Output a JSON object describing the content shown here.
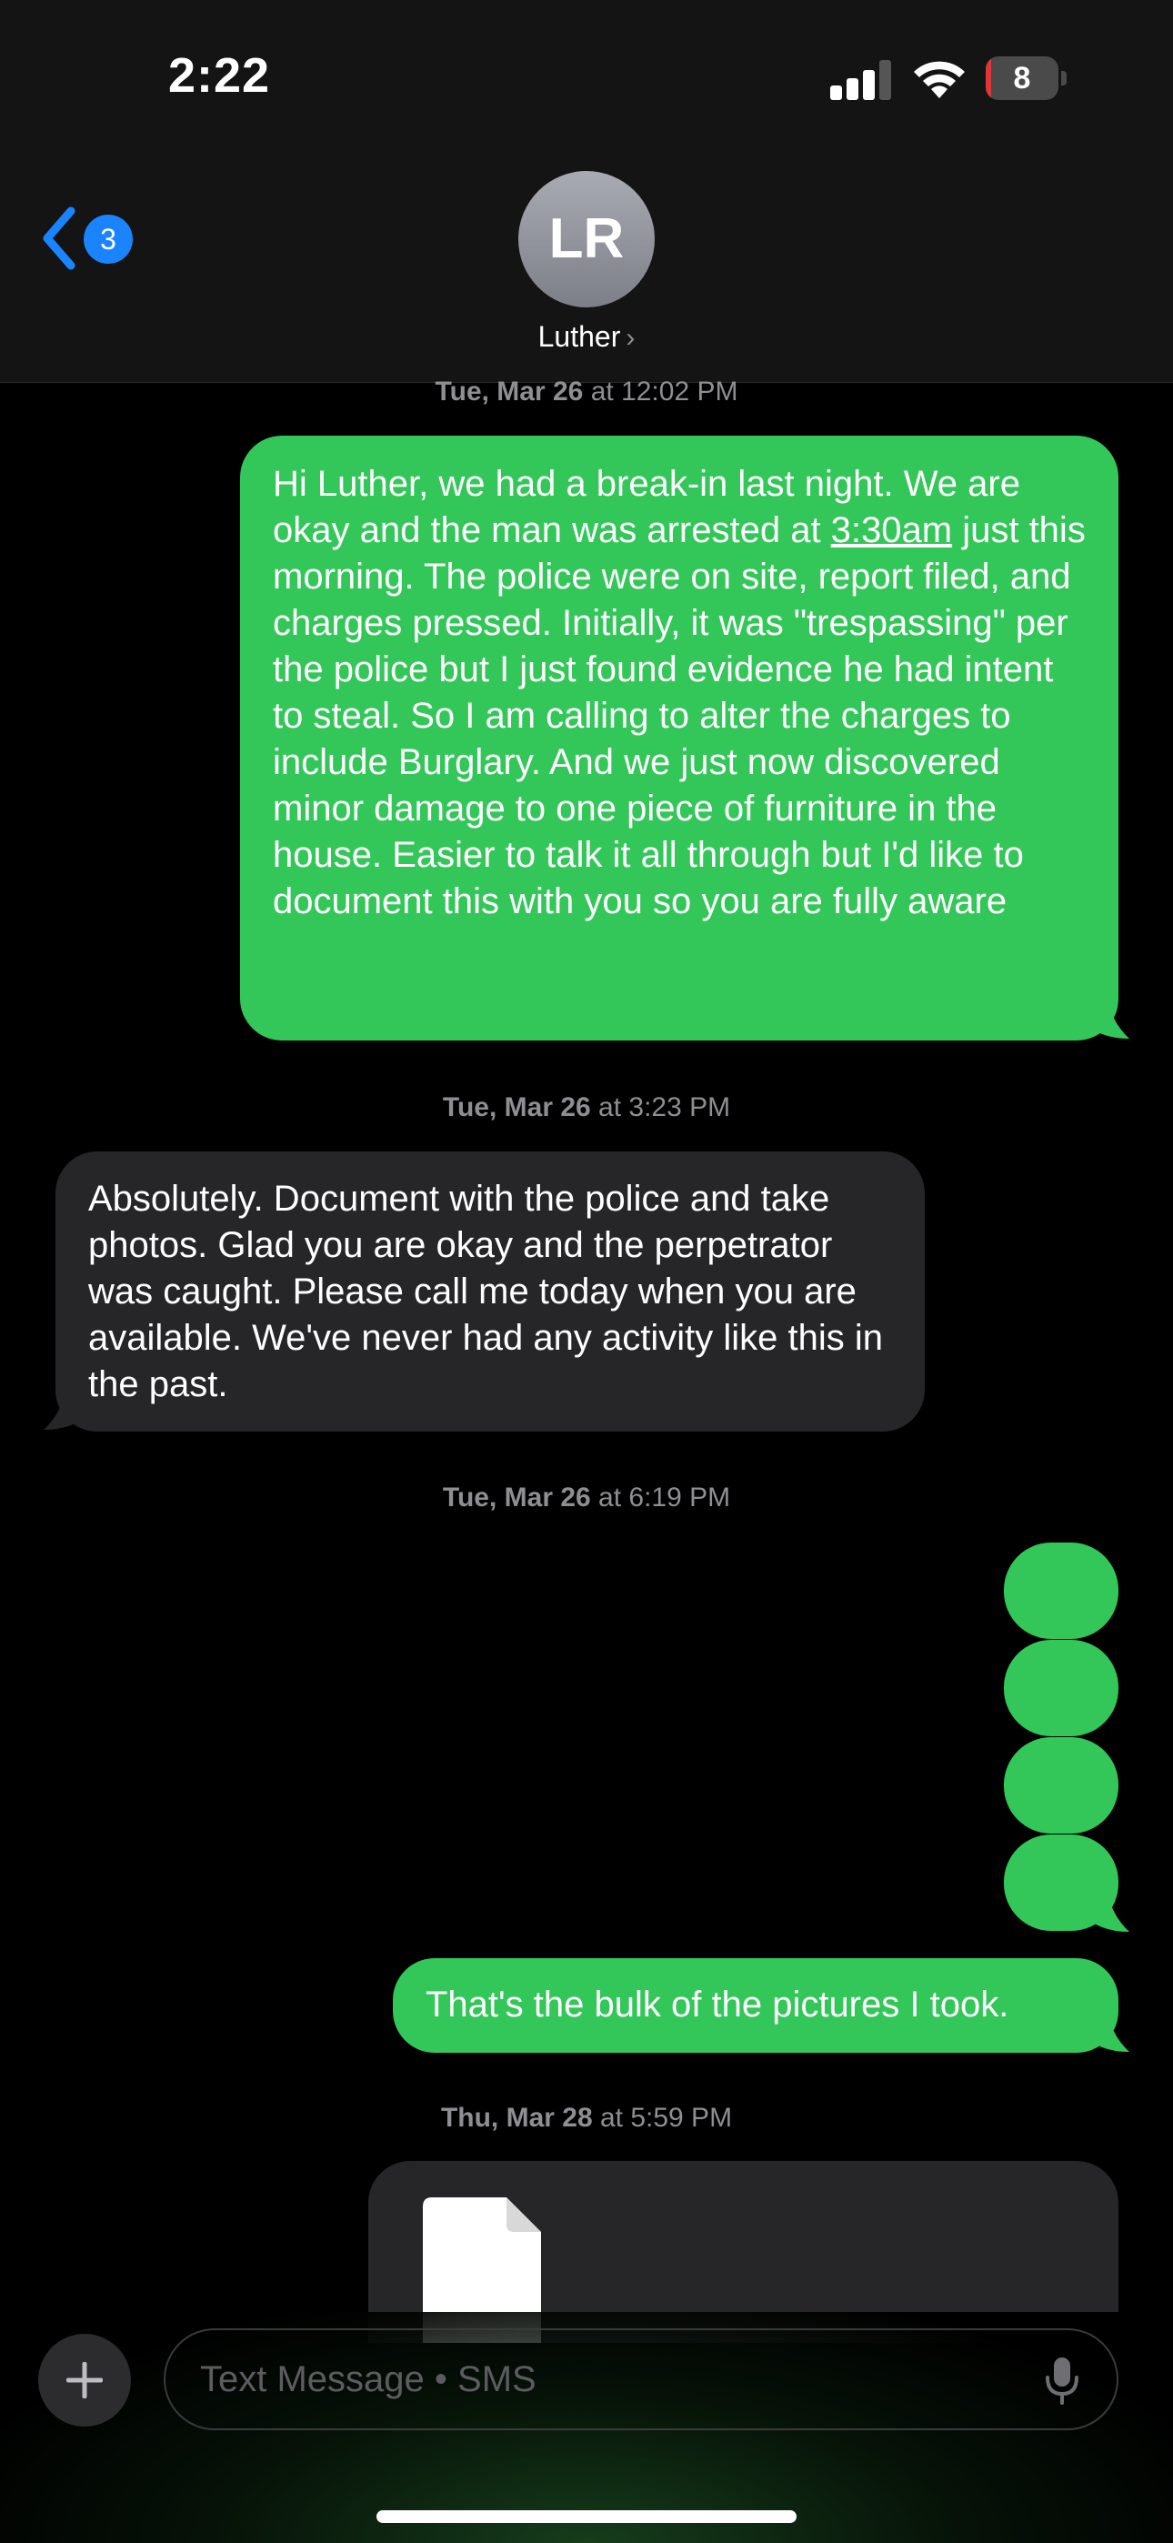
{
  "status_bar": {
    "time": "2:22",
    "battery_level": "8",
    "battery_fraction": 0.08
  },
  "header": {
    "unread_count": "3",
    "avatar_initials": "LR",
    "contact_name": "Luther"
  },
  "messages": [
    {
      "timestamp_day": "Tue, Mar 26",
      "timestamp_time": " at 12:02 PM",
      "direction": "sent",
      "text_before_link": "Hi Luther, we had a break-in last night. We are okay and the man was arrested at ",
      "link_text": "3:30am",
      "text_after_link": " just this morning. The police were on site, report filed, and charges pressed. Initially, it was \"trespassing\" per the police but I just found evidence he had intent to steal. So I am calling to alter the charges to include Burglary. And we just now discovered minor damage to one piece of furniture in the house. Easier to talk it all through but I'd like to document this with you so you are fully aware"
    },
    {
      "timestamp_day": "Tue, Mar 26",
      "timestamp_time": " at 3:23 PM",
      "direction": "received",
      "text": "Absolutely. Document with the police and take photos. Glad you are okay and the perpetrator was caught. Please call me today when you are available. We've never had any activity like this in the past."
    },
    {
      "timestamp_day": "Tue, Mar 26",
      "timestamp_time": " at 6:19 PM",
      "direction": "sent",
      "photo_count": 4
    },
    {
      "direction": "sent",
      "text": "That's the bulk of the pictures I took."
    },
    {
      "timestamp_day": "Thu, Mar 28",
      "timestamp_time": " at 5:59 PM",
      "direction": "received",
      "attachment_icon": "document-icon"
    }
  ],
  "input": {
    "placeholder": "Text Message • SMS"
  },
  "colors": {
    "sent_bubble": "#33c759",
    "received_bubble": "#262628",
    "accent": "#1a84ff"
  }
}
